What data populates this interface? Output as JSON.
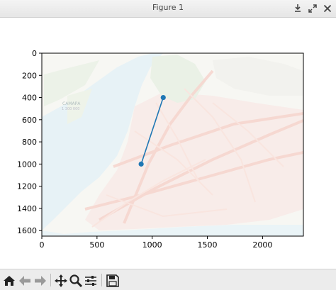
{
  "window": {
    "title": "Figure 1"
  },
  "toolbar": {
    "buttons": [
      "home-icon",
      "back-arrow-icon",
      "forward-arrow-icon",
      "pan-move-icon",
      "zoom-magnifier-icon",
      "subplots-config-icon",
      "save-disk-icon"
    ]
  },
  "map_labels": {
    "city": "САМАРА",
    "population": "1 300 000"
  },
  "chart_data": {
    "type": "line",
    "title": "",
    "xlabel": "",
    "ylabel": "",
    "xlim": [
      0,
      2370
    ],
    "ylim": [
      1650,
      0
    ],
    "y_inverted": true,
    "xticks": [
      0,
      500,
      1000,
      1500,
      2000
    ],
    "yticks": [
      0,
      200,
      400,
      600,
      800,
      1000,
      1200,
      1400,
      1600
    ],
    "grid": false,
    "legend": "none",
    "background": "faded street map image",
    "series": [
      {
        "x": [
          900,
          1100
        ],
        "y": [
          1000,
          400
        ],
        "color": "#1f77b4",
        "marker": "o"
      }
    ]
  }
}
